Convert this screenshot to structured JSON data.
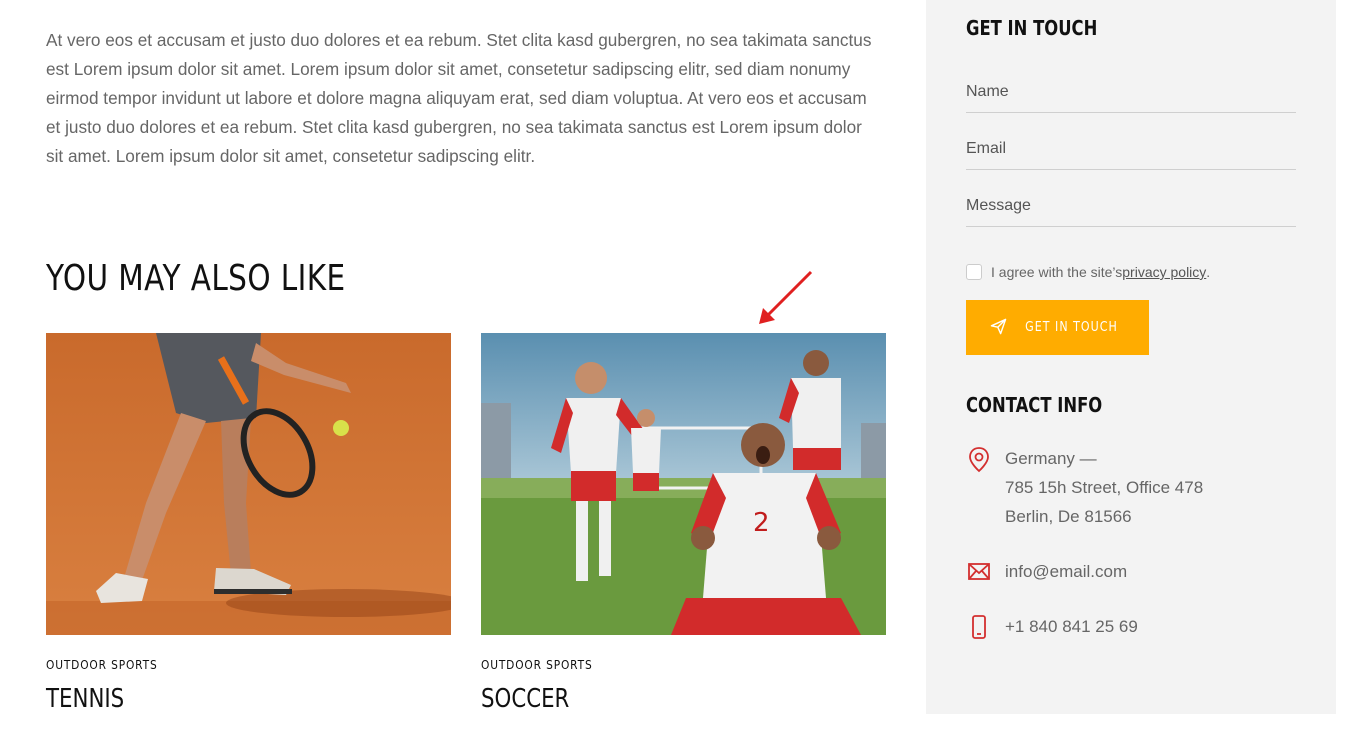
{
  "intro": {
    "paragraph": "At vero eos et accusam et justo duo dolores et ea rebum. Stet clita kasd gubergren, no sea takimata sanctus est Lorem ipsum dolor sit amet. Lorem ipsum dolor sit amet, consetetur sadipscing elitr, sed diam nonumy eirmod tempor invidunt ut labore et dolore magna aliquyam erat, sed diam voluptua. At vero eos et accusam et justo duo dolores et ea rebum. Stet clita kasd gubergren, no sea takimata sanctus est Lorem ipsum dolor sit amet. Lorem ipsum dolor sit amet, consetetur sadipscing elitr."
  },
  "related": {
    "title": "YOU MAY ALSO LIKE",
    "cards": [
      {
        "category": "OUTDOOR SPORTS",
        "title": "TENNIS",
        "image": "tennis-photo"
      },
      {
        "category": "OUTDOOR SPORTS",
        "title": "SOCCER",
        "image": "soccer-photo"
      }
    ]
  },
  "sidebar": {
    "contact_form": {
      "title": "GET IN TOUCH",
      "name_placeholder": "Name",
      "email_placeholder": "Email",
      "message_placeholder": "Message",
      "agree_text": "I agree with the site’s ",
      "policy_link": "privacy policy",
      "agree_suffix": ".",
      "button_label": "GET IN TOUCH",
      "button_icon": "send-icon",
      "accent_color": "#ffac00"
    },
    "contact_info": {
      "title": "CONTACT INFO",
      "address_line1": "Germany —",
      "address_line2": "785 15h Street, Office 478",
      "address_line3": "Berlin, De 81566",
      "email": "info@email.com",
      "phone": "+1 840 841 25 69",
      "icon_color": "#d32f2f"
    }
  }
}
